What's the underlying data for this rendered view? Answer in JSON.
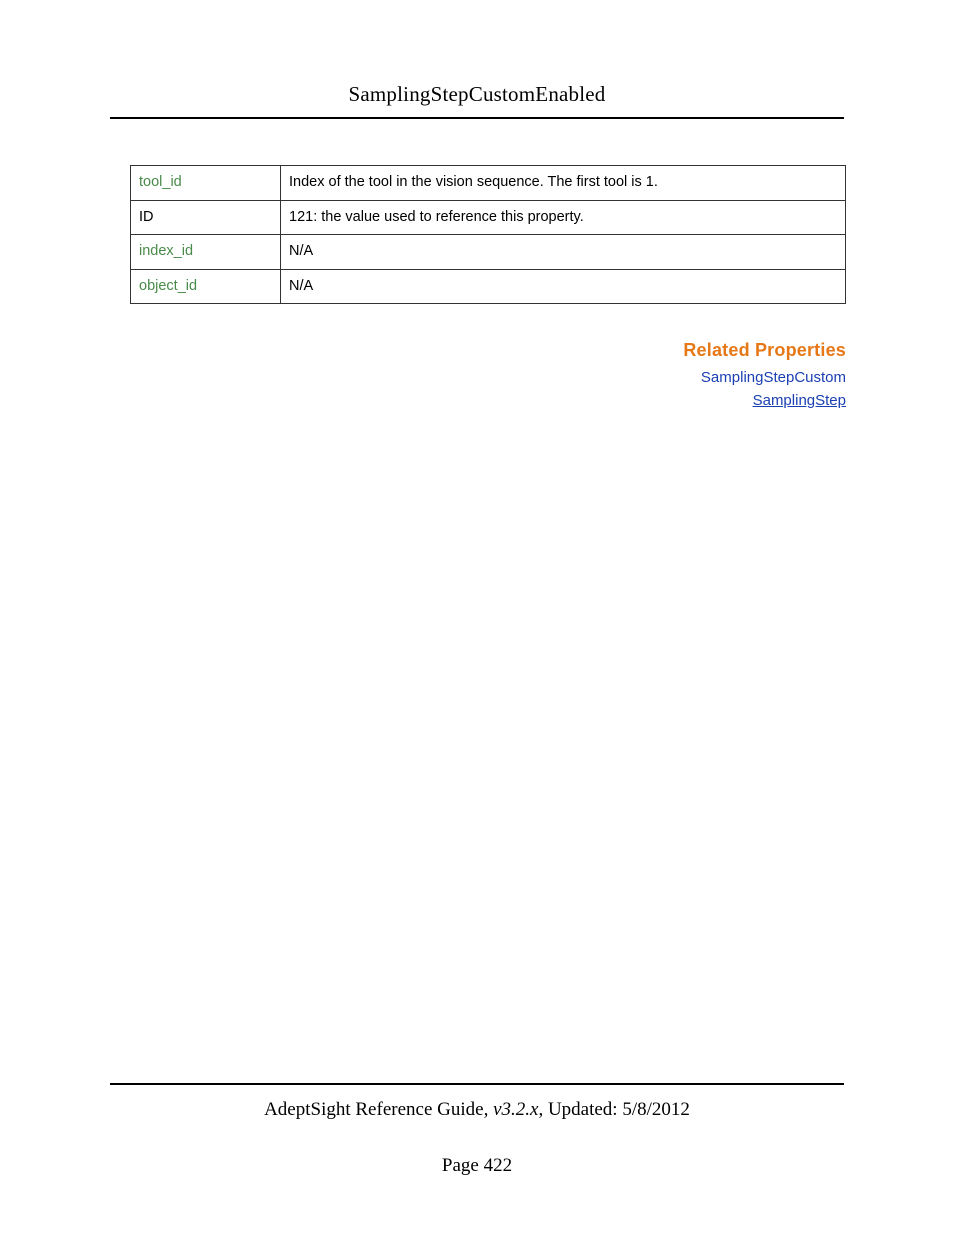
{
  "header": {
    "title": "SamplingStepCustomEnabled"
  },
  "table": {
    "rows": [
      {
        "key": "tool_id",
        "keyClass": "green",
        "value": "Index of the tool in the vision sequence. The first tool is 1."
      },
      {
        "key": "ID",
        "keyClass": "plain",
        "value": "121: the value used to reference this property."
      },
      {
        "key": "index_id",
        "keyClass": "green",
        "value": "N/A"
      },
      {
        "key": "object_id",
        "keyClass": "green",
        "value": "N/A"
      }
    ]
  },
  "related": {
    "heading": "Related Properties",
    "links": [
      {
        "label": "SamplingStepCustom",
        "underlined": false
      },
      {
        "label": "SamplingStep",
        "underlined": true
      }
    ]
  },
  "footer": {
    "guide": "AdeptSight Reference Guide",
    "version": ", v3.2.x",
    "updated_prefix": ", Updated: ",
    "updated_date": "5/8/2012",
    "page_label": "Page 422"
  }
}
